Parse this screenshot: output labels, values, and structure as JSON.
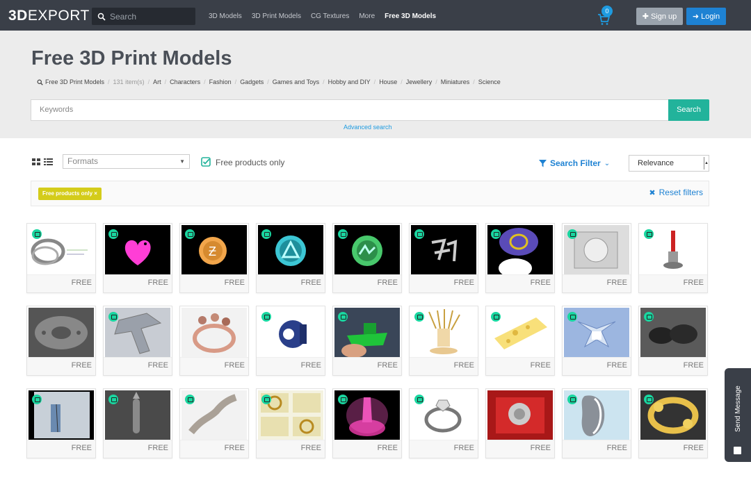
{
  "brand": {
    "logo_bold": "3D",
    "logo_rest": "EXPORT"
  },
  "header": {
    "search_placeholder": "Search",
    "nav": [
      "3D Models",
      "3D Print Models",
      "CG Textures",
      "More",
      "Free 3D Models"
    ],
    "cart_count": "0",
    "signup_label": "Sign up",
    "login_label": "Login"
  },
  "hero": {
    "title": "Free 3D Print Models",
    "breadcrumb_root": "Free 3D Print Models",
    "item_count": "131 item(s)",
    "categories": [
      "Art",
      "Characters",
      "Fashion",
      "Gadgets",
      "Games and Toys",
      "Hobby and DIY",
      "House",
      "Jewellery",
      "Miniatures",
      "Science"
    ],
    "keywords_placeholder": "Keywords",
    "search_button": "Search",
    "advanced_search": "Advanced search"
  },
  "toolbar": {
    "formats_label": "Formats",
    "free_only_label": "Free products only",
    "search_filter_label": "Search Filter",
    "sort_value": "Relevance",
    "chip_label": "Free products only",
    "reset_label": "Reset filters"
  },
  "products": {
    "price_label": "FREE",
    "rows": [
      [
        "ring-silver",
        "heart-pink",
        "pendant-orange",
        "pendant-blue",
        "pendant-green",
        "calligraphy-glyph",
        "disc-purple",
        "box-fitting",
        "red-cylinder-stand"
      ],
      [
        "wheel-gray",
        "celtic-cross",
        "ring-rose-gold",
        "blue-gear-part",
        "green-benchy-boat",
        "hand-with-claws",
        "cheese-block",
        "eagle-crest",
        "dark-figures"
      ],
      [
        "pendant-plate",
        "bullet-shell",
        "blurry-branch",
        "gold-jewel-drawing",
        "pink-glow-lamp",
        "diamond-ring",
        "red-jewelry-box",
        "gray-vase-shape",
        "gold-twisted-ring"
      ]
    ]
  },
  "side_tab": {
    "label": "Send Message"
  },
  "colors": {
    "accent_teal": "#22b39b",
    "accent_blue": "#1e82d3",
    "topbar": "#3a3f48",
    "chip_yellow": "#d4cc1a",
    "badge_green": "#19d6a0"
  }
}
